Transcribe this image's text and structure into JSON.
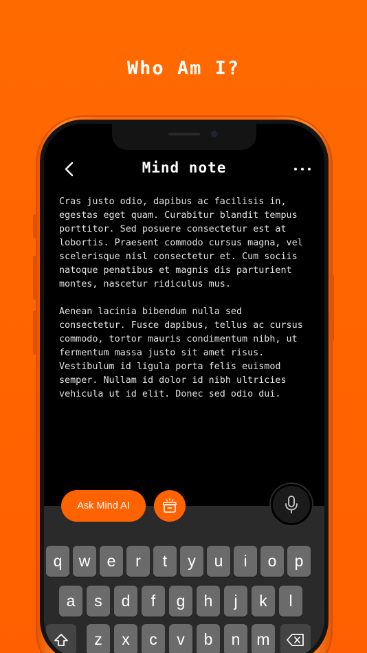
{
  "headline": "Who Am I?",
  "nav": {
    "title": "Mind note"
  },
  "note": {
    "paragraphs": [
      "Cras justo odio, dapibus ac facilisis in, egestas eget quam. Curabitur blandit tempus porttitor. Sed posuere consectetur est at lobortis. Praesent commodo cursus magna, vel scelerisque nisl consectetur et. Cum sociis natoque penatibus et magnis dis parturient montes, nascetur ridiculus mus.",
      "Aenean lacinia bibendum nulla sed consectetur. Fusce dapibus, tellus ac cursus commodo, tortor mauris condimentum nibh, ut fermentum massa justo sit amet risus. Vestibulum id ligula porta felis euismod semper. Nullam id dolor id nibh ultricies vehicula ut id elit. Donec sed odio dui."
    ]
  },
  "ai_bar": {
    "ask_label": "Ask Mind AI"
  },
  "keyboard": {
    "row1": [
      "q",
      "w",
      "e",
      "r",
      "t",
      "y",
      "u",
      "i",
      "o",
      "p"
    ],
    "row2": [
      "a",
      "s",
      "d",
      "f",
      "g",
      "h",
      "j",
      "k",
      "l"
    ],
    "row3": [
      "z",
      "x",
      "c",
      "v",
      "b",
      "n",
      "m"
    ]
  },
  "colors": {
    "accent": "#ff6200",
    "background": "#ff6a00",
    "screen": "#000000",
    "key": "#6b6b6b"
  },
  "icons": [
    "chevron-left-icon",
    "more-dots-icon",
    "gift-box-icon",
    "microphone-icon",
    "shift-icon",
    "backspace-icon"
  ]
}
